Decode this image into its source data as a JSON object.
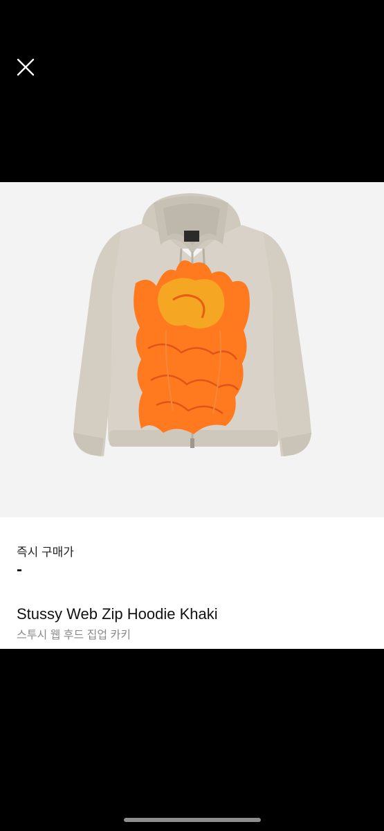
{
  "header": {
    "close_icon": "close-icon"
  },
  "product_image": {
    "subject": "hoodie-icon",
    "background_color": "#f3f3f3",
    "garment_color": "#d8d2c8",
    "graphic_color": "#ff7a1e"
  },
  "price": {
    "label": "즉시 구매가",
    "value": "-"
  },
  "product": {
    "name": "Stussy Web Zip Hoodie Khaki",
    "name_ko": "스투시 웹 후드 집업 카키"
  }
}
